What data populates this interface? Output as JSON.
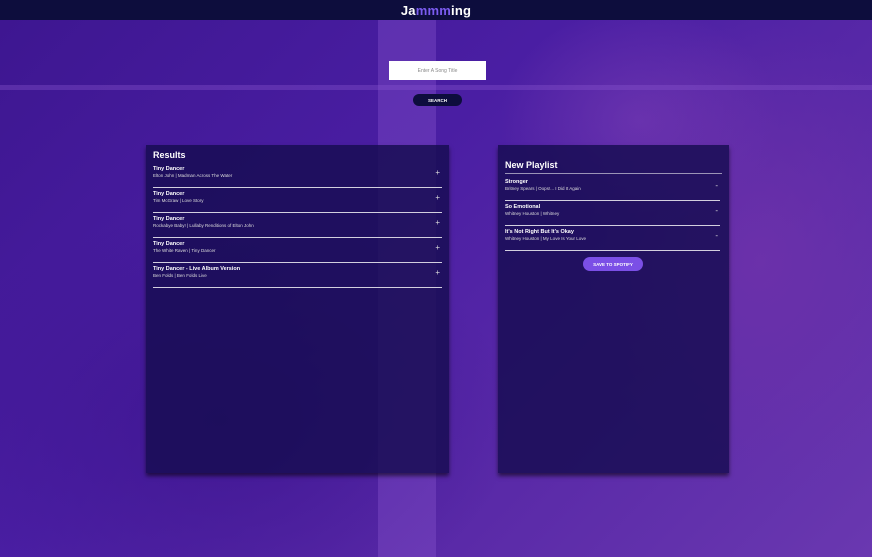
{
  "app": {
    "logo_prefix": "Ja",
    "logo_highlight": "mmm",
    "logo_suffix": "ing",
    "accent_color": "#7b5cf0",
    "topbar_color": "#0d0d3d"
  },
  "search": {
    "placeholder": "Enter A Song Title",
    "button_label": "SEARCH"
  },
  "results": {
    "title": "Results",
    "add_icon": "+",
    "tracks": [
      {
        "name": "Tiny Dancer",
        "info": "Elton John | Madman Across The Water"
      },
      {
        "name": "Tiny Dancer",
        "info": "Tim McGraw | Love Story"
      },
      {
        "name": "Tiny Dancer",
        "info": "Rockabye Baby! | Lullaby Renditions of Elton John"
      },
      {
        "name": "Tiny Dancer",
        "info": "The White Raven | Tiny Dancer"
      },
      {
        "name": "Tiny Dancer - Live Album Version",
        "info": "Ben Folds | Ben Folds Live"
      }
    ]
  },
  "playlist": {
    "title": "New Playlist",
    "remove_icon": "-",
    "save_label": "SAVE TO SPOTIFY",
    "save_color": "#7b4fe6",
    "tracks": [
      {
        "name": "Stronger",
        "info": "Britney Spears | Oops!... I Did It Again"
      },
      {
        "name": "So Emotional",
        "info": "Whitney Houston | Whitney"
      },
      {
        "name": "It's Not Right But It's Okay",
        "info": "Whitney Houston | My Love Is Your Love"
      }
    ]
  }
}
